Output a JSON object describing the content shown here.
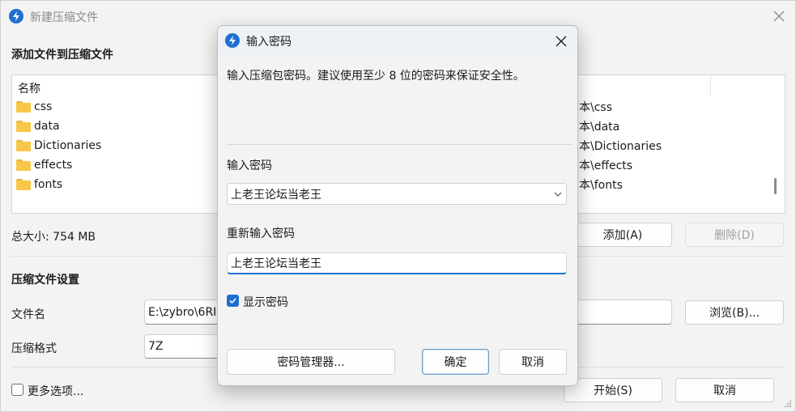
{
  "main": {
    "title": "新建压缩文件",
    "add_section_title": "添加文件到压缩文件",
    "list": {
      "column_name": "名称",
      "items": [
        {
          "name": "css",
          "path": "本\\css"
        },
        {
          "name": "data",
          "path": "本\\data"
        },
        {
          "name": "Dictionaries",
          "path": "本\\Dictionaries"
        },
        {
          "name": "effects",
          "path": "本\\effects"
        },
        {
          "name": "fonts",
          "path": "本\\fonts"
        }
      ]
    },
    "total_size": "总大小: 754 MB",
    "add_button": "添加(A)",
    "delete_button": "删除(D)",
    "settings_title": "压缩文件设置",
    "filename_label": "文件名",
    "filename_value": "E:\\zybro\\6RI",
    "browse_button": "浏览(B)...",
    "format_label": "压缩格式",
    "format_value": "7Z",
    "more_options": "更多选项...",
    "start_button": "开始(S)",
    "cancel_button": "取消"
  },
  "dialog": {
    "title": "输入密码",
    "description": "输入压缩包密码。建议使用至少 8 位的密码来保证安全性。",
    "password_label": "输入密码",
    "password_value": "上老王论坛当老王",
    "confirm_label": "重新输入密码",
    "confirm_value": "上老王论坛当老王",
    "show_password_label": "显示密码",
    "show_password_checked": true,
    "manager_button": "密码管理器...",
    "ok_button": "确定",
    "cancel_button": "取消"
  },
  "colors": {
    "accent": "#1e6fd1",
    "folder": "#f8c74a"
  }
}
